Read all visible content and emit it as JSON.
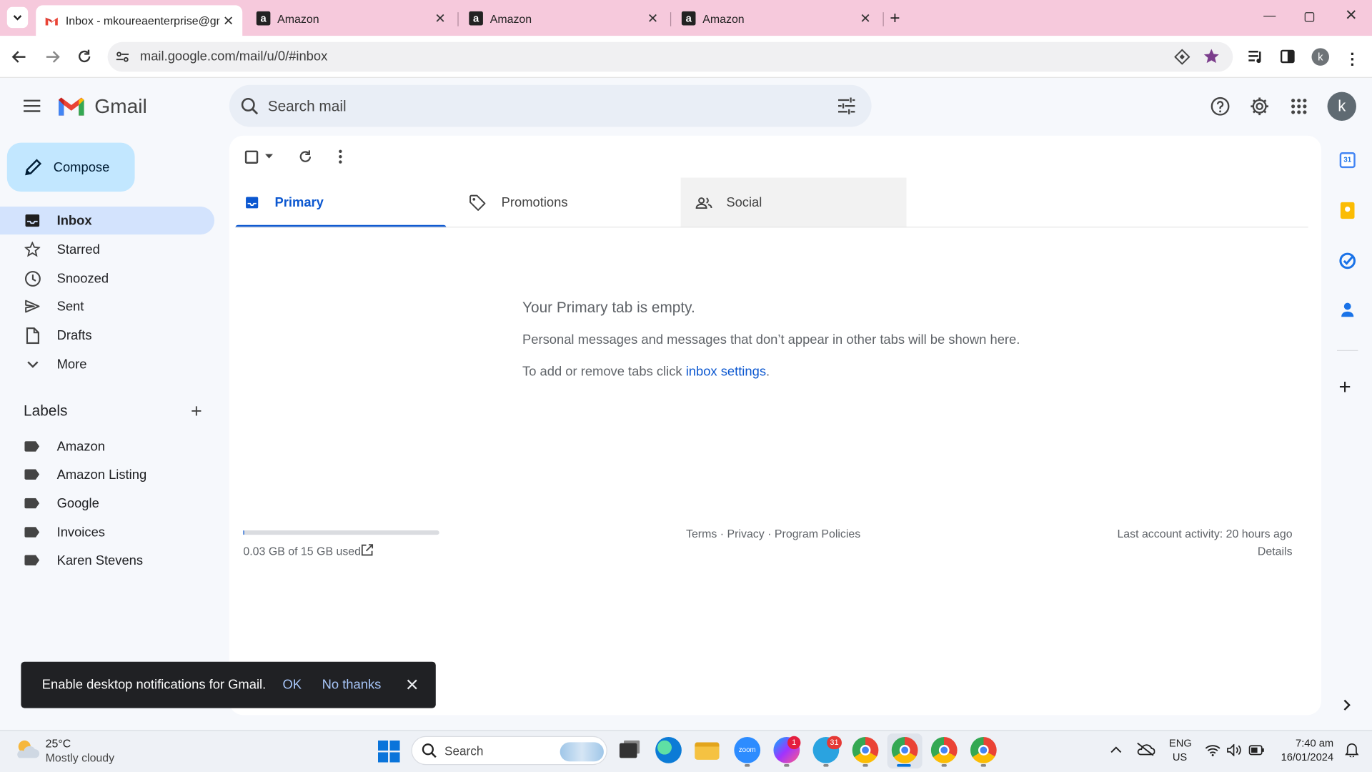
{
  "browser": {
    "tabs": [
      {
        "title": "Inbox - mkoureaenterprise@gm",
        "active": true,
        "icon": "gmail-icon"
      },
      {
        "title": "Amazon",
        "active": false,
        "icon": "amazon-icon"
      },
      {
        "title": "Amazon",
        "active": false,
        "icon": "amazon-icon"
      },
      {
        "title": "Amazon",
        "active": false,
        "icon": "amazon-icon"
      }
    ],
    "url": "mail.google.com/mail/u/0/#inbox",
    "profile_initial": "k"
  },
  "gmail": {
    "brand": "Gmail",
    "search_placeholder": "Search mail",
    "account_initial": "k",
    "compose_label": "Compose",
    "nav": [
      {
        "label": "Inbox",
        "icon": "inbox-icon",
        "selected": true
      },
      {
        "label": "Starred",
        "icon": "star-icon",
        "selected": false
      },
      {
        "label": "Snoozed",
        "icon": "clock-icon",
        "selected": false
      },
      {
        "label": "Sent",
        "icon": "send-icon",
        "selected": false
      },
      {
        "label": "Drafts",
        "icon": "draft-icon",
        "selected": false
      },
      {
        "label": "More",
        "icon": "chevron-down-icon",
        "selected": false
      }
    ],
    "labels_heading": "Labels",
    "labels": [
      "Amazon",
      "Amazon Listing",
      "Google",
      "Invoices",
      "Karen Stevens"
    ],
    "inbox_tabs": [
      {
        "label": "Primary",
        "icon": "inbox-icon",
        "active": true
      },
      {
        "label": "Promotions",
        "icon": "tag-icon",
        "active": false
      },
      {
        "label": "Social",
        "icon": "people-icon",
        "active": false
      }
    ],
    "empty_state": {
      "title": "Your Primary tab is empty.",
      "desc": "Personal messages and messages that don’t appear in other tabs will be shown here.",
      "settings_prefix": "To add or remove tabs click ",
      "settings_link": "inbox settings",
      "settings_suffix": "."
    },
    "footer": {
      "storage": "0.03 GB of 15 GB used",
      "storage_fraction": 0.002,
      "terms": "Terms",
      "privacy": "Privacy",
      "policies": "Program Policies",
      "sep": "·",
      "last_activity": "Last account activity: 20 hours ago",
      "details": "Details"
    },
    "toast": {
      "message": "Enable desktop notifications for Gmail.",
      "ok": "OK",
      "no_thanks": "No thanks"
    },
    "side_panel": [
      "calendar-icon",
      "keep-icon",
      "tasks-icon",
      "contacts-icon"
    ],
    "calendar_day": "31"
  },
  "taskbar": {
    "weather_temp": "25°C",
    "weather_desc": "Mostly cloudy",
    "search_label": "Search",
    "lang_top": "ENG",
    "lang_bottom": "US",
    "time": "7:40 am",
    "date": "16/01/2024",
    "badges": {
      "messenger": "1",
      "telegram": "31"
    }
  },
  "colors": {
    "tab_strip": "#f6c9dc",
    "accent_blue": "#0b57d0",
    "compose_bg": "#c2e7ff",
    "nav_selected": "#d3e3fd"
  }
}
